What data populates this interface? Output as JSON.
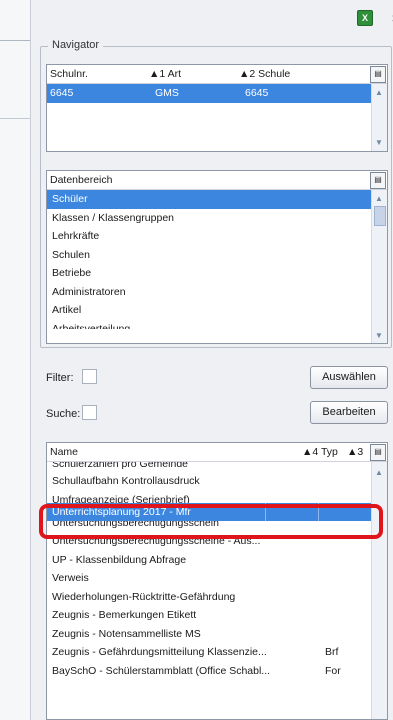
{
  "toolbar": {
    "excel_icon": "excel-export-icon",
    "close_label": "×"
  },
  "navigator": {
    "title": "Navigator",
    "columns": [
      "Schulnr.",
      "1 Art",
      "2 Schule"
    ],
    "rows": [
      {
        "schulnr": "6645",
        "art": "GMS",
        "schule": "6645",
        "selected": true
      }
    ]
  },
  "datenbereich": {
    "header": "Datenbereich",
    "items": [
      {
        "label": "Schüler",
        "selected": true
      },
      {
        "label": "Klassen / Klassengruppen"
      },
      {
        "label": "Lehrkräfte"
      },
      {
        "label": "Schulen"
      },
      {
        "label": "Betriebe"
      },
      {
        "label": "Administratoren"
      },
      {
        "label": "Artikel"
      },
      {
        "label": "Arbeitsverteilung"
      }
    ]
  },
  "filter": {
    "label": "Filter:",
    "button": "Auswählen"
  },
  "suche": {
    "label": "Suche:",
    "button": "Bearbeiten"
  },
  "reports": {
    "columns": {
      "name": "Name",
      "typ": "4 Typ",
      "third": "3"
    },
    "items": [
      {
        "name": "Schülerzahlen pro Gemeinde",
        "typ": ""
      },
      {
        "name": "Schullaufbahn Kontrollausdruck",
        "typ": ""
      },
      {
        "name": "Umfrageanzeige (Serienbrief)",
        "typ": ""
      },
      {
        "name": "Unterrichtsplanung 2017 - Mfr",
        "typ": "",
        "selected": true
      },
      {
        "name": "Untersuchungsberechtigungsschein",
        "typ": ""
      },
      {
        "name": "Untersuchungsberechtigungsscheine - Aus...",
        "typ": ""
      },
      {
        "name": "UP - Klassenbildung Abfrage",
        "typ": ""
      },
      {
        "name": "Verweis",
        "typ": ""
      },
      {
        "name": "Wiederholungen-Rücktritte-Gefährdung",
        "typ": ""
      },
      {
        "name": "Zeugnis - Bemerkungen Etikett",
        "typ": ""
      },
      {
        "name": "Zeugnis - Notensammelliste MS",
        "typ": ""
      },
      {
        "name": "Zeugnis - Gefährdungsmitteilung Klassenzie...",
        "typ": "Brf"
      },
      {
        "name": "BaySchO - Schülerstammblatt (Office Schabl...",
        "typ": "For"
      }
    ]
  },
  "colors": {
    "selection": "#3c86e0",
    "highlight": "#e0141b"
  }
}
